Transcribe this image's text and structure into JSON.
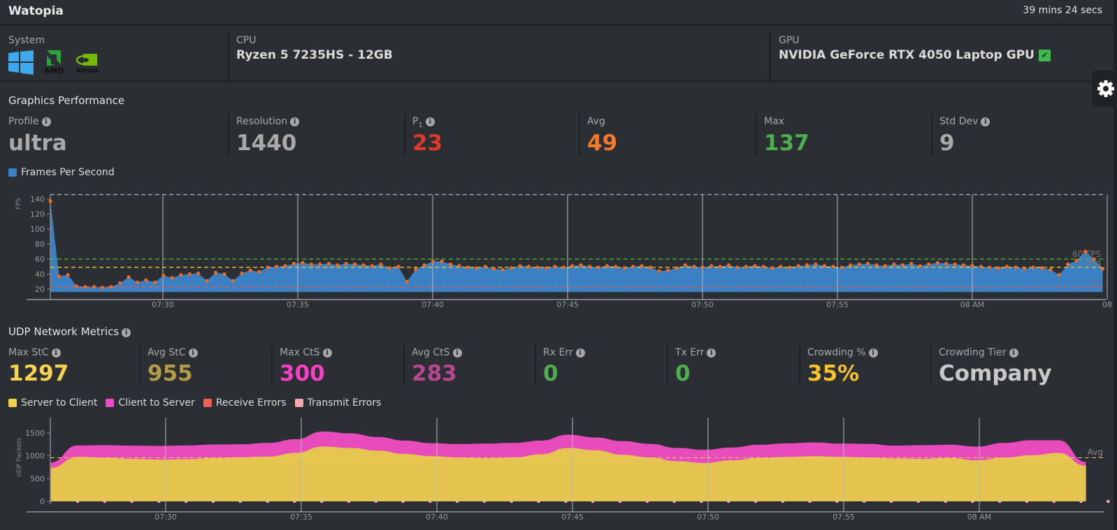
{
  "header": {
    "title": "Watopia",
    "elapsed": "39 mins 24 secs"
  },
  "system": {
    "label": "System",
    "icons": [
      "windows-logo",
      "amd-logo",
      "nvidia-logo"
    ],
    "logo_text": {
      "amd": "AMD",
      "nvidia": "NVIDIA"
    },
    "cpu_label": "CPU",
    "cpu_value": "Ryzen 5 7235HS - 12GB",
    "gpu_label": "GPU",
    "gpu_value": "NVIDIA GeForce RTX 4050 Laptop GPU",
    "gpu_check": "✔"
  },
  "graphics": {
    "title": "Graphics Performance",
    "stats": [
      {
        "label": "Profile",
        "value": "ultra",
        "info": true,
        "color": "#a9a9a9"
      },
      {
        "label": "Resolution",
        "value": "1440",
        "info": true,
        "color": "#a9a9a9"
      },
      {
        "label": "P",
        "sub": "1",
        "value": "23",
        "info": true,
        "color": "#e0392b"
      },
      {
        "label": "Avg",
        "value": "49",
        "info": false,
        "color": "#f47b2c"
      },
      {
        "label": "Max",
        "value": "137",
        "info": false,
        "color": "#4cae4f"
      },
      {
        "label": "Std Dev",
        "value": "9",
        "info": true,
        "color": "#a9a9a9"
      }
    ],
    "legend": "Frames Per Second"
  },
  "udp": {
    "title": "UDP Network Metrics",
    "stats": [
      {
        "label": "Max StC",
        "value": "1297",
        "color": "#f7d24c"
      },
      {
        "label": "Avg StC",
        "value": "955",
        "color": "#b49b48"
      },
      {
        "label": "Max CtS",
        "value": "300",
        "color": "#f540c6"
      },
      {
        "label": "Avg CtS",
        "value": "283",
        "color": "#b9478f"
      },
      {
        "label": "Rx Err",
        "value": "0",
        "color": "#4cae4f"
      },
      {
        "label": "Tx Err",
        "value": "0",
        "color": "#4cae4f"
      },
      {
        "label": "Crowding %",
        "value": "35%",
        "color": "#f7c12c"
      },
      {
        "label": "Crowding Tier",
        "value": "Company",
        "color": "#c8c8c8"
      }
    ],
    "legend": [
      {
        "label": "Server to Client",
        "color": "#f2d050"
      },
      {
        "label": "Client to Server",
        "color": "#f04ac8"
      },
      {
        "label": "Receive Errors",
        "color": "#ee6055"
      },
      {
        "label": "Transmit Errors",
        "color": "#f6a8b0"
      }
    ]
  },
  "chart_data": [
    {
      "type": "area",
      "name": "fps",
      "ylabel": "FPS",
      "ylim": [
        16,
        148
      ],
      "yticks": [
        20,
        40,
        60,
        80,
        100,
        120,
        140
      ],
      "start": "07:25:50",
      "end": "08:04:50",
      "xticks": [
        {
          "label": "07:30",
          "t": "07:30:00"
        },
        {
          "label": "07:35",
          "t": "07:35:00"
        },
        {
          "label": "07:40",
          "t": "07:40:00"
        },
        {
          "label": "07:45",
          "t": "07:45:00"
        },
        {
          "label": "07:50",
          "t": "07:50:00"
        },
        {
          "label": "07:55",
          "t": "07:55:00"
        },
        {
          "label": "08 AM",
          "t": "08:00:00"
        },
        {
          "label": "08",
          "t": "08:05:00"
        }
      ],
      "lines": [
        {
          "label": "",
          "value": 146,
          "color": "#8fb3c8"
        },
        {
          "label": "60 FPS",
          "value": 60,
          "color": "#4cbf3a"
        },
        {
          "label": "Avg",
          "value": 49,
          "color": "#e8c532"
        },
        {
          "label": "p1",
          "value": 23,
          "color": "#ee5a4a"
        }
      ],
      "fill_color": "#3a80c2",
      "point_color": "#f26a21",
      "values": [
        137,
        37,
        39,
        24,
        23,
        23,
        22,
        23,
        28,
        36,
        29,
        32,
        29,
        38,
        35,
        39,
        40,
        41,
        31,
        42,
        40,
        31,
        41,
        45,
        43,
        49,
        50,
        51,
        54,
        55,
        53,
        53,
        54,
        52,
        54,
        53,
        52,
        51,
        53,
        48,
        50,
        30,
        46,
        52,
        57,
        57,
        53,
        51,
        49,
        48,
        50,
        47,
        46,
        48,
        51,
        50,
        49,
        48,
        50,
        49,
        51,
        52,
        50,
        49,
        51,
        50,
        48,
        50,
        51,
        49,
        44,
        45,
        48,
        52,
        50,
        49,
        51,
        50,
        52,
        49,
        50,
        51,
        50,
        48,
        50,
        49,
        51,
        52,
        53,
        51,
        50,
        49,
        52,
        53,
        54,
        52,
        51,
        53,
        52,
        54,
        51,
        53,
        55,
        54,
        53,
        52,
        51,
        50,
        49,
        48,
        50,
        49,
        47,
        49,
        48,
        46,
        39,
        53,
        58,
        70,
        60,
        47
      ]
    },
    {
      "type": "stacked-area",
      "name": "udp",
      "ylabel": "UDP Packets",
      "ylim": [
        0,
        1700
      ],
      "yticks": [
        0,
        500,
        1000,
        1500
      ],
      "start": "07:25:45",
      "end": "08:03:56",
      "xticks": [
        {
          "label": "07:30",
          "t": "07:30:00"
        },
        {
          "label": "07:35",
          "t": "07:35:00"
        },
        {
          "label": "07:40",
          "t": "07:40:00"
        },
        {
          "label": "07:45",
          "t": "07:45:00"
        },
        {
          "label": "07:50",
          "t": "07:50:00"
        },
        {
          "label": "07:55",
          "t": "07:55:00"
        },
        {
          "label": "08 AM",
          "t": "08:00:00"
        }
      ],
      "avg_line": {
        "label": "Avg",
        "value": 955
      },
      "series": [
        {
          "name": "Server to Client",
          "color": "#e6c450",
          "values": [
            730,
            975,
            955,
            930,
            915,
            925,
            950,
            965,
            980,
            1060,
            1200,
            1170,
            1110,
            1040,
            990,
            960,
            945,
            960,
            1030,
            1170,
            1120,
            1020,
            960,
            880,
            840,
            900,
            950,
            970,
            990,
            975,
            960,
            940,
            930,
            950,
            900,
            960,
            1010,
            1060,
            780
          ]
        },
        {
          "name": "Client to Server",
          "color": "#e84bbb",
          "values": [
            120,
            250,
            275,
            290,
            300,
            300,
            295,
            285,
            300,
            300,
            330,
            320,
            300,
            290,
            285,
            295,
            320,
            320,
            300,
            290,
            280,
            300,
            300,
            290,
            290,
            280,
            290,
            300,
            300,
            290,
            300,
            280,
            300,
            290,
            300,
            320,
            330,
            280,
            80
          ]
        },
        {
          "name": "Receive Errors",
          "color": "#ee6055",
          "values": [
            0,
            0,
            0,
            0,
            0,
            0,
            0,
            0,
            0,
            0,
            0,
            0,
            0,
            0,
            0,
            0,
            0,
            0,
            0,
            0,
            0,
            0,
            0,
            0,
            0,
            0,
            0,
            0,
            0,
            0,
            0,
            0,
            0,
            0,
            0,
            0,
            0,
            0,
            0,
            0
          ]
        },
        {
          "name": "Transmit Errors",
          "color": "#f6a8b0",
          "values": [
            0,
            0,
            0,
            0,
            0,
            0,
            0,
            0,
            0,
            0,
            0,
            0,
            0,
            0,
            0,
            0,
            0,
            0,
            0,
            0,
            0,
            0,
            0,
            0,
            0,
            0,
            0,
            0,
            0,
            0,
            0,
            0,
            0,
            0,
            0,
            0,
            0,
            0,
            0,
            0
          ]
        }
      ]
    }
  ]
}
